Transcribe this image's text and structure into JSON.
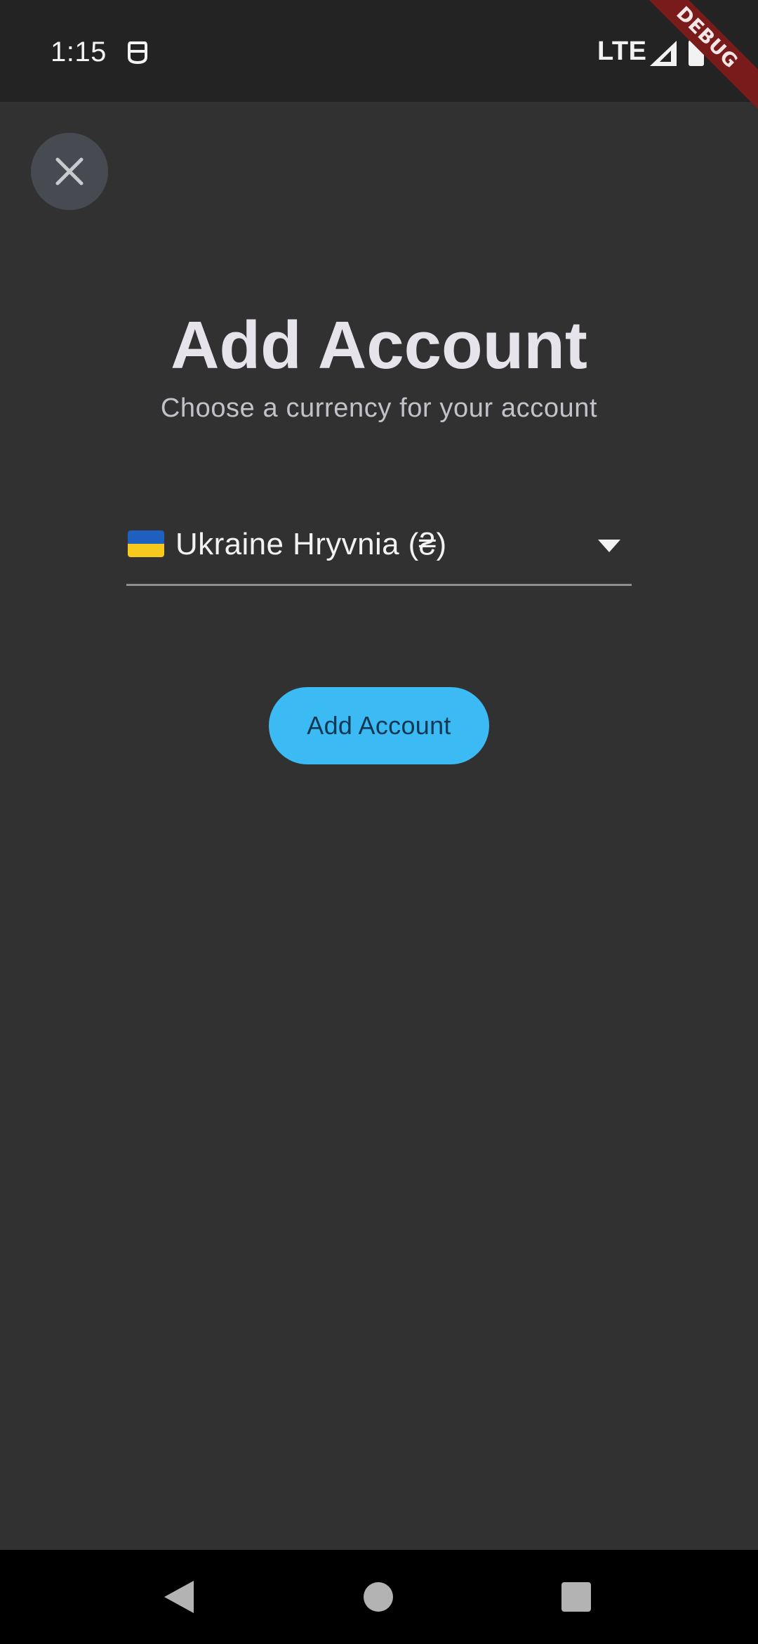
{
  "status_bar": {
    "time": "1:15",
    "network": "LTE",
    "icons": [
      "app-notification-icon",
      "signal-icon",
      "battery-icon"
    ]
  },
  "debug_banner": "DEBUG",
  "close_button": {
    "icon": "close-icon"
  },
  "header": {
    "title": "Add Account",
    "subtitle": "Choose a currency for your account"
  },
  "currency_select": {
    "flag_icon": "ukraine-flag-icon",
    "selected_value": "Ukraine Hryvnia (₴)",
    "caret_icon": "chevron-down-icon"
  },
  "primary_button": {
    "label": "Add Account"
  },
  "navigation_bar": {
    "icons": [
      "back-icon",
      "home-icon",
      "recents-icon"
    ]
  },
  "colors": {
    "background": "#313131",
    "status_bar": "#232323",
    "accent": "#3cbaf3",
    "debug_ribbon": "#7a1b1b"
  }
}
